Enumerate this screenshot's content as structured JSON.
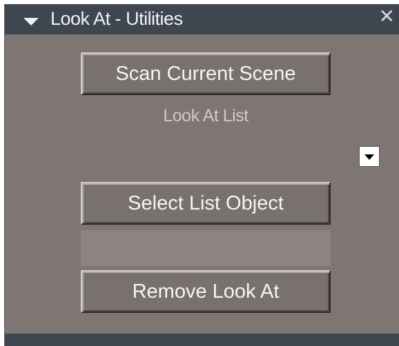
{
  "window": {
    "title": "Look At - Utilities",
    "close_symbol": "✕"
  },
  "buttons": {
    "scan": "Scan Current Scene",
    "select": "Select List Object",
    "remove": "Remove Look At"
  },
  "list": {
    "label": "Look At List",
    "selected_value": ""
  },
  "icons": {
    "collapse": "collapse-arrow-icon",
    "close": "close-icon",
    "dropdown": "chevron-down-icon"
  },
  "colors": {
    "panel_bg": "#7f7674",
    "titlebar_bg": "#3e4650",
    "button_bg": "#787170"
  }
}
